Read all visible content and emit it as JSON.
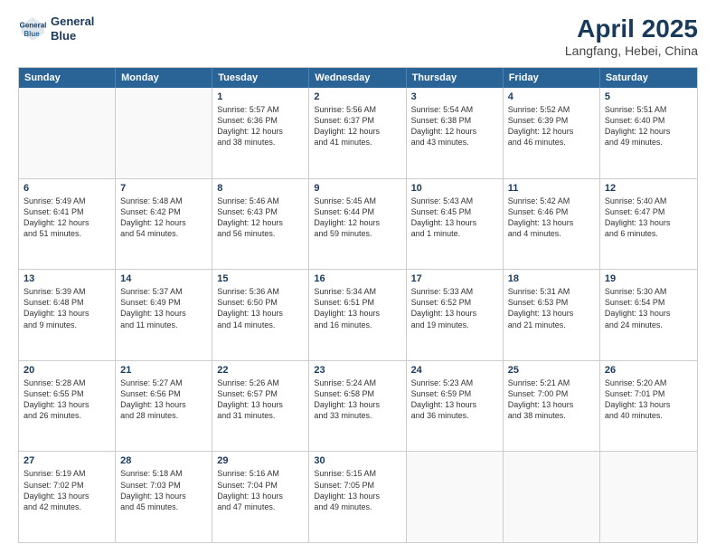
{
  "header": {
    "logo_line1": "General",
    "logo_line2": "Blue",
    "month": "April 2025",
    "location": "Langfang, Hebei, China"
  },
  "weekdays": [
    "Sunday",
    "Monday",
    "Tuesday",
    "Wednesday",
    "Thursday",
    "Friday",
    "Saturday"
  ],
  "rows": [
    [
      {
        "day": "",
        "lines": []
      },
      {
        "day": "",
        "lines": []
      },
      {
        "day": "1",
        "lines": [
          "Sunrise: 5:57 AM",
          "Sunset: 6:36 PM",
          "Daylight: 12 hours",
          "and 38 minutes."
        ]
      },
      {
        "day": "2",
        "lines": [
          "Sunrise: 5:56 AM",
          "Sunset: 6:37 PM",
          "Daylight: 12 hours",
          "and 41 minutes."
        ]
      },
      {
        "day": "3",
        "lines": [
          "Sunrise: 5:54 AM",
          "Sunset: 6:38 PM",
          "Daylight: 12 hours",
          "and 43 minutes."
        ]
      },
      {
        "day": "4",
        "lines": [
          "Sunrise: 5:52 AM",
          "Sunset: 6:39 PM",
          "Daylight: 12 hours",
          "and 46 minutes."
        ]
      },
      {
        "day": "5",
        "lines": [
          "Sunrise: 5:51 AM",
          "Sunset: 6:40 PM",
          "Daylight: 12 hours",
          "and 49 minutes."
        ]
      }
    ],
    [
      {
        "day": "6",
        "lines": [
          "Sunrise: 5:49 AM",
          "Sunset: 6:41 PM",
          "Daylight: 12 hours",
          "and 51 minutes."
        ]
      },
      {
        "day": "7",
        "lines": [
          "Sunrise: 5:48 AM",
          "Sunset: 6:42 PM",
          "Daylight: 12 hours",
          "and 54 minutes."
        ]
      },
      {
        "day": "8",
        "lines": [
          "Sunrise: 5:46 AM",
          "Sunset: 6:43 PM",
          "Daylight: 12 hours",
          "and 56 minutes."
        ]
      },
      {
        "day": "9",
        "lines": [
          "Sunrise: 5:45 AM",
          "Sunset: 6:44 PM",
          "Daylight: 12 hours",
          "and 59 minutes."
        ]
      },
      {
        "day": "10",
        "lines": [
          "Sunrise: 5:43 AM",
          "Sunset: 6:45 PM",
          "Daylight: 13 hours",
          "and 1 minute."
        ]
      },
      {
        "day": "11",
        "lines": [
          "Sunrise: 5:42 AM",
          "Sunset: 6:46 PM",
          "Daylight: 13 hours",
          "and 4 minutes."
        ]
      },
      {
        "day": "12",
        "lines": [
          "Sunrise: 5:40 AM",
          "Sunset: 6:47 PM",
          "Daylight: 13 hours",
          "and 6 minutes."
        ]
      }
    ],
    [
      {
        "day": "13",
        "lines": [
          "Sunrise: 5:39 AM",
          "Sunset: 6:48 PM",
          "Daylight: 13 hours",
          "and 9 minutes."
        ]
      },
      {
        "day": "14",
        "lines": [
          "Sunrise: 5:37 AM",
          "Sunset: 6:49 PM",
          "Daylight: 13 hours",
          "and 11 minutes."
        ]
      },
      {
        "day": "15",
        "lines": [
          "Sunrise: 5:36 AM",
          "Sunset: 6:50 PM",
          "Daylight: 13 hours",
          "and 14 minutes."
        ]
      },
      {
        "day": "16",
        "lines": [
          "Sunrise: 5:34 AM",
          "Sunset: 6:51 PM",
          "Daylight: 13 hours",
          "and 16 minutes."
        ]
      },
      {
        "day": "17",
        "lines": [
          "Sunrise: 5:33 AM",
          "Sunset: 6:52 PM",
          "Daylight: 13 hours",
          "and 19 minutes."
        ]
      },
      {
        "day": "18",
        "lines": [
          "Sunrise: 5:31 AM",
          "Sunset: 6:53 PM",
          "Daylight: 13 hours",
          "and 21 minutes."
        ]
      },
      {
        "day": "19",
        "lines": [
          "Sunrise: 5:30 AM",
          "Sunset: 6:54 PM",
          "Daylight: 13 hours",
          "and 24 minutes."
        ]
      }
    ],
    [
      {
        "day": "20",
        "lines": [
          "Sunrise: 5:28 AM",
          "Sunset: 6:55 PM",
          "Daylight: 13 hours",
          "and 26 minutes."
        ]
      },
      {
        "day": "21",
        "lines": [
          "Sunrise: 5:27 AM",
          "Sunset: 6:56 PM",
          "Daylight: 13 hours",
          "and 28 minutes."
        ]
      },
      {
        "day": "22",
        "lines": [
          "Sunrise: 5:26 AM",
          "Sunset: 6:57 PM",
          "Daylight: 13 hours",
          "and 31 minutes."
        ]
      },
      {
        "day": "23",
        "lines": [
          "Sunrise: 5:24 AM",
          "Sunset: 6:58 PM",
          "Daylight: 13 hours",
          "and 33 minutes."
        ]
      },
      {
        "day": "24",
        "lines": [
          "Sunrise: 5:23 AM",
          "Sunset: 6:59 PM",
          "Daylight: 13 hours",
          "and 36 minutes."
        ]
      },
      {
        "day": "25",
        "lines": [
          "Sunrise: 5:21 AM",
          "Sunset: 7:00 PM",
          "Daylight: 13 hours",
          "and 38 minutes."
        ]
      },
      {
        "day": "26",
        "lines": [
          "Sunrise: 5:20 AM",
          "Sunset: 7:01 PM",
          "Daylight: 13 hours",
          "and 40 minutes."
        ]
      }
    ],
    [
      {
        "day": "27",
        "lines": [
          "Sunrise: 5:19 AM",
          "Sunset: 7:02 PM",
          "Daylight: 13 hours",
          "and 42 minutes."
        ]
      },
      {
        "day": "28",
        "lines": [
          "Sunrise: 5:18 AM",
          "Sunset: 7:03 PM",
          "Daylight: 13 hours",
          "and 45 minutes."
        ]
      },
      {
        "day": "29",
        "lines": [
          "Sunrise: 5:16 AM",
          "Sunset: 7:04 PM",
          "Daylight: 13 hours",
          "and 47 minutes."
        ]
      },
      {
        "day": "30",
        "lines": [
          "Sunrise: 5:15 AM",
          "Sunset: 7:05 PM",
          "Daylight: 13 hours",
          "and 49 minutes."
        ]
      },
      {
        "day": "",
        "lines": []
      },
      {
        "day": "",
        "lines": []
      },
      {
        "day": "",
        "lines": []
      }
    ]
  ]
}
